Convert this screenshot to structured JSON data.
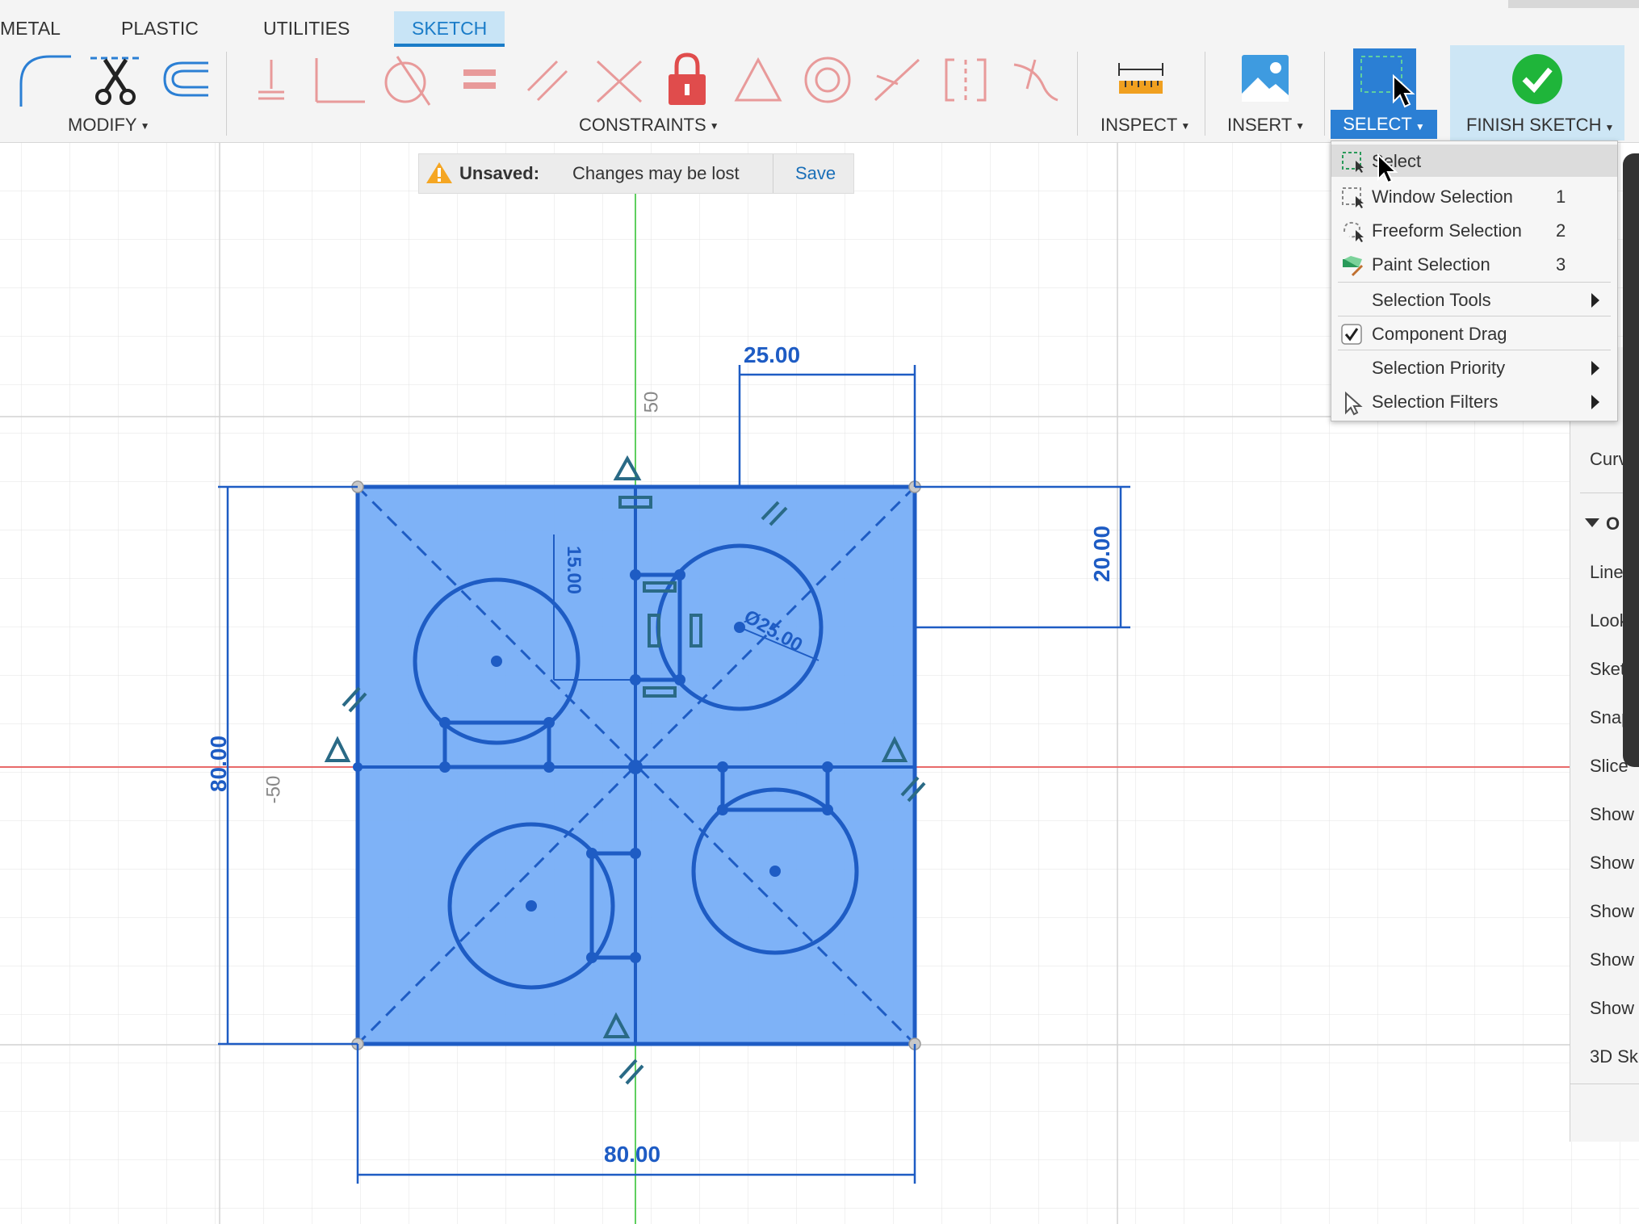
{
  "tabs": [
    "METAL",
    "PLASTIC",
    "UTILITIES",
    "SKETCH"
  ],
  "active_tab": "SKETCH",
  "ribbon": {
    "modify_label": "MODIFY",
    "constraints_label": "CONSTRAINTS",
    "inspect_label": "INSPECT",
    "insert_label": "INSERT",
    "select_label": "SELECT",
    "finish_label": "FINISH SKETCH"
  },
  "unsaved": {
    "label": "Unsaved:",
    "message": "Changes may be lost",
    "save": "Save"
  },
  "select_menu": [
    {
      "label": "Select",
      "shortcut": ""
    },
    {
      "label": "Window Selection",
      "shortcut": "1"
    },
    {
      "label": "Freeform Selection",
      "shortcut": "2"
    },
    {
      "label": "Paint Selection",
      "shortcut": "3"
    },
    {
      "label": "Selection Tools",
      "shortcut": ""
    },
    {
      "label": "Component Drag",
      "shortcut": ""
    },
    {
      "label": "Selection Priority",
      "shortcut": ""
    },
    {
      "label": "Selection Filters",
      "shortcut": ""
    }
  ],
  "component_drag_checked": true,
  "sketch_palette": {
    "items": [
      "Curv",
      "O",
      "Line",
      "Look",
      "Sket",
      "Snap",
      "Slice",
      "Show",
      "Show",
      "Show",
      "Show",
      "Show",
      "3D Sk"
    ]
  },
  "dimensions": {
    "top_width": "25.00",
    "right_height": "20.00",
    "inner_vertical": "15.00",
    "circle_diameter": "Ø25.00",
    "overall_height": "80.00",
    "overall_width": "80.00",
    "axis_label_top": "50",
    "axis_label_left": "-50"
  },
  "colors": {
    "accent": "#1a7cc8",
    "sketch_fill": "#77aef7",
    "sketch_line": "#1e5cc4",
    "x_axis": "#e86a6a",
    "y_axis": "#5fcf5f",
    "constraint_icon": "#e89a9a",
    "finish_green": "#1fb53a"
  }
}
